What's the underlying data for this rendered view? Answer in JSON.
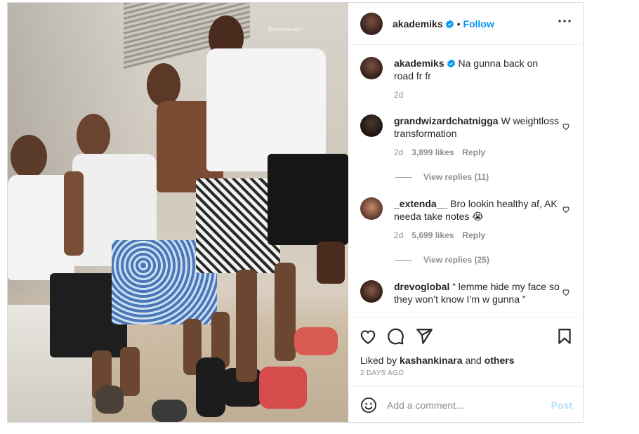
{
  "post": {
    "photo_watermark": "@gunnafandom",
    "header": {
      "username": "akademiks",
      "dot": "•",
      "follow_label": "Follow",
      "verified": true
    },
    "caption": {
      "username": "akademiks",
      "text": "Na gunna back on road fr fr",
      "age": "2d"
    },
    "comments": [
      {
        "username": "grandwizardchatnigga",
        "text": "W weightloss transformation",
        "age": "2d",
        "likes": "3,899 likes",
        "reply": "Reply",
        "view_replies": "View replies (11)"
      },
      {
        "username": "_extenda__",
        "text": "Bro lookin healthy af, AK needa take notes 😭",
        "age": "2d",
        "likes": "5,699 likes",
        "reply": "Reply",
        "view_replies": "View replies (25)"
      },
      {
        "username": "drevoglobal",
        "text": "“ lemme hide my face so they won’t know I’m w gunna ”"
      }
    ],
    "liked_by": {
      "prefix": "Liked by",
      "user": "kashankinara",
      "and": "and",
      "others": "others"
    },
    "date": "2 DAYS AGO",
    "add_comment": {
      "placeholder": "Add a comment...",
      "post_label": "Post"
    },
    "colors": {
      "accent": "#0095f6",
      "post_disabled": "#b2dffc",
      "muted": "#8e8e8e",
      "text": "#262626"
    }
  }
}
